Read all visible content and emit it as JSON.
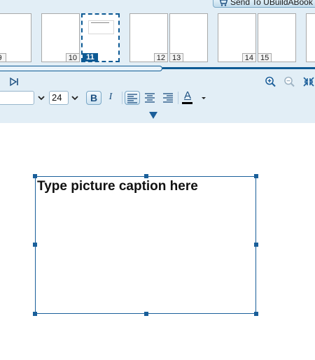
{
  "header": {
    "send_button_label": "Send To  UBuildABook",
    "cart_icon": "shopping-cart-icon"
  },
  "thumbnails": [
    {
      "page": "9",
      "selected": false
    },
    {
      "page": "10",
      "selected": false
    },
    {
      "page": "11",
      "selected": true
    },
    {
      "page": "12",
      "selected": false
    },
    {
      "page": "13",
      "selected": false
    },
    {
      "page": "14",
      "selected": false
    },
    {
      "page": "15",
      "selected": false
    },
    {
      "page": "",
      "selected": false
    }
  ],
  "toolbar": {
    "skip_end_icon": "skip-to-end-icon",
    "zoom_in_icon": "zoom-in-icon",
    "zoom_out_icon": "zoom-out-icon",
    "fit_icon": "fit-to-window-icon"
  },
  "format": {
    "font_name": "",
    "font_size": "24",
    "bold_label": "B",
    "italic_label": "I",
    "align_left_icon": "align-left-icon",
    "align_center_icon": "align-center-icon",
    "align_right_icon": "align-right-icon",
    "text_color_label": "A",
    "text_color": "#000000",
    "accent": "#0e5a94"
  },
  "canvas": {
    "caption_text": "Type picture caption here"
  }
}
